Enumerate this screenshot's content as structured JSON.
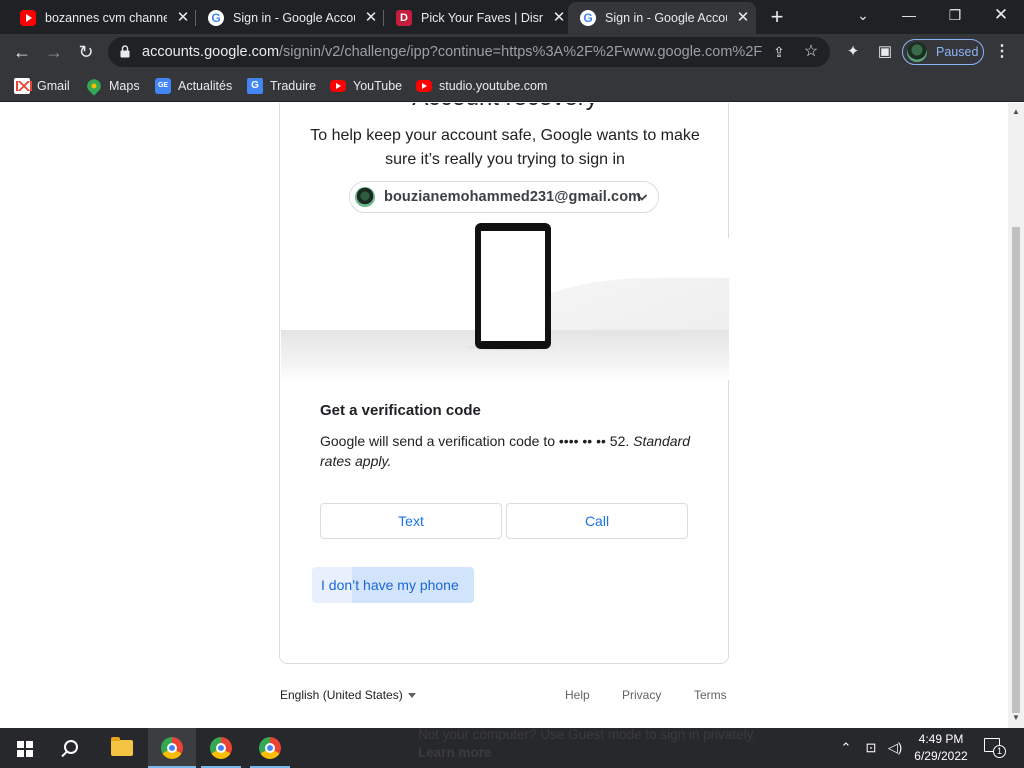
{
  "tabs": [
    {
      "title": "bozannes cvm channel - YouTube",
      "favicon": "youtube-icon",
      "active": false
    },
    {
      "title": "Sign in - Google Accounts",
      "favicon": "google-icon",
      "active": false
    },
    {
      "title": "Pick Your Faves | Disney+",
      "favicon": "disney-icon",
      "active": false
    },
    {
      "title": "Sign in - Google Accounts",
      "favicon": "google-icon",
      "active": true
    }
  ],
  "toolbar": {
    "url_domain": "accounts.google.com",
    "url_path": "/signin/v2/challenge/ipp?continue=https%3A%2F%2Fwww.google.com%2F&...",
    "profile_status": "Paused"
  },
  "bookmarks": [
    {
      "label": "Gmail",
      "icon": "gmail-icon"
    },
    {
      "label": "Maps",
      "icon": "maps-icon"
    },
    {
      "label": "Actualités",
      "icon": "news-icon"
    },
    {
      "label": "Traduire",
      "icon": "translate-icon"
    },
    {
      "label": "YouTube",
      "icon": "youtube-icon"
    },
    {
      "label": "studio.youtube.com",
      "icon": "youtube-icon"
    }
  ],
  "page": {
    "heading": "Account recovery",
    "subtitle": "To help keep your account safe, Google wants to make sure it’s really you trying to sign in",
    "account_email": "bouzianemohammed231@gmail.com",
    "section_title": "Get a verification code",
    "section_body_main": "Google will send a verification code to •••• •• •• 52.",
    "section_body_note": "Standard rates apply.",
    "text_button": "Text",
    "call_button": "Call",
    "no_phone_link": "I don’t have my phone"
  },
  "footer": {
    "language": "English (United States)",
    "help": "Help",
    "privacy": "Privacy",
    "terms": "Terms",
    "hidden_notice": "Not your computer? Use Guest mode to sign in privately.",
    "hidden_link": "Learn more"
  },
  "taskbar": {
    "time": "4:49 PM",
    "date": "6/29/2022",
    "notification_count": "1"
  },
  "colors": {
    "accent": "#1a73e8",
    "chrome_dark": "#202124",
    "chrome_toolbar": "#35363a"
  }
}
